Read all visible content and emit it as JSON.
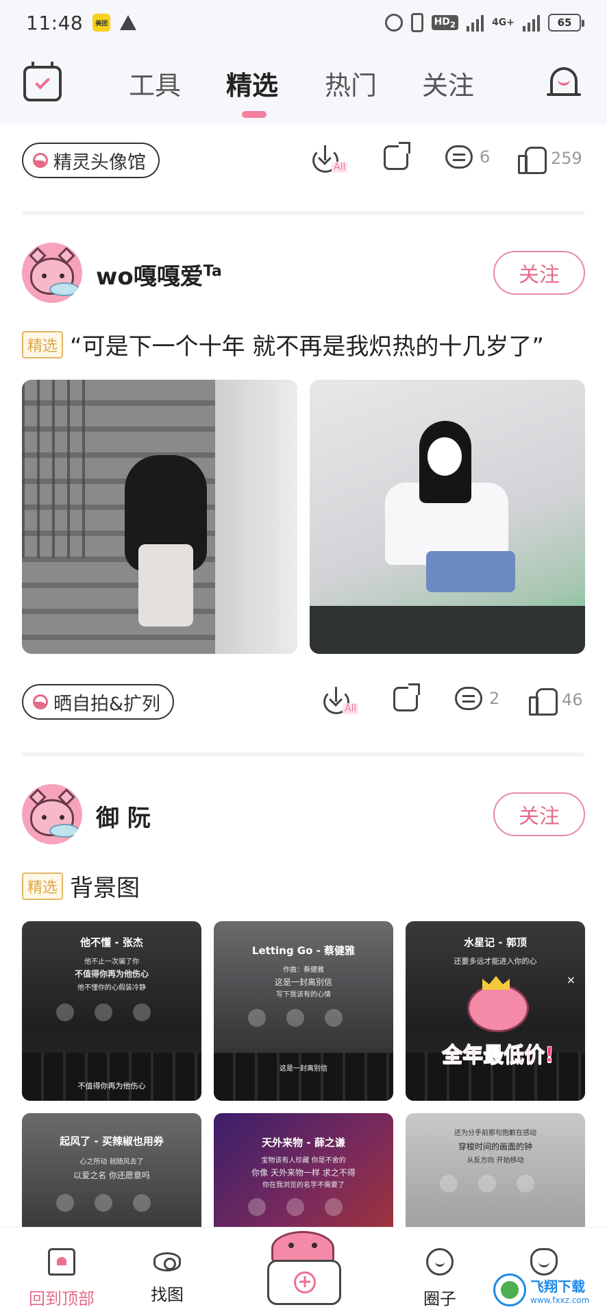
{
  "status_bar": {
    "time": "11:48",
    "badge": "美团",
    "hd": "HD",
    "hd_sub": "2",
    "net": "4G+",
    "battery": "65"
  },
  "nav": {
    "tabs": [
      "工具",
      "精选",
      "热门",
      "关注"
    ],
    "active_tab": "精选"
  },
  "post0": {
    "tag": "精灵头像馆",
    "download_badge": "All",
    "comments": "6",
    "likes": "259"
  },
  "post1": {
    "username": "wo嘎嘎爱",
    "username_sup": "Ta",
    "follow_label": "关注",
    "badge": "精选",
    "caption": "“可是下一个十年 就不再是我炽热的十几岁了”",
    "tag": "晒自拍&扩列",
    "download_badge": "All",
    "comments": "2",
    "likes": "46"
  },
  "post2": {
    "username": "御 阮",
    "follow_label": "关注",
    "badge": "精选",
    "caption": "背景图",
    "thumbs": [
      {
        "title": "他不懂 - 张杰",
        "lines": [
          "他不止一次骗了你",
          "不值得你再为他伤心",
          "他不懂你的心假装冷静"
        ],
        "bottom": "不值得你再为他伤心"
      },
      {
        "title": "Letting Go - 蔡健雅",
        "lines": [
          "作曲：蔡健雅",
          "这是一封离别信",
          "写下我该有的心情"
        ],
        "bottom": "这是一封离别信"
      },
      {
        "title": "水星记 - 郭顶",
        "lines": [
          "还要多远才能进入你的心"
        ],
        "promo": "全年最低价!",
        "close": "×"
      },
      {
        "title": "起风了 - 买辣椒也用券",
        "lines": [
          "心之所动 就随风去了",
          "以爱之名 你还愿意吗"
        ]
      },
      {
        "title": "天外来物 - 薛之谦",
        "lines": [
          "宝物该有人珍藏 你是不舍的",
          "你像 天外来物一样 求之不得",
          "你在我浏览的名字不需要了"
        ]
      },
      {
        "title": "",
        "lines": [
          "还为分手前那句抱歉在感动",
          "穿梭时间的画面的钟",
          "从反方向 开始移动"
        ]
      }
    ]
  },
  "bottom_nav": {
    "items": [
      "回到顶部",
      "找图",
      "",
      "圈子",
      ""
    ]
  },
  "watermark": {
    "main": "飞翔下载",
    "sub": "www.fxxz.com"
  },
  "colors": {
    "accent": "#e46c8a",
    "badge_gold": "#d9a94a",
    "nav_bg": "#f6f7fb"
  }
}
